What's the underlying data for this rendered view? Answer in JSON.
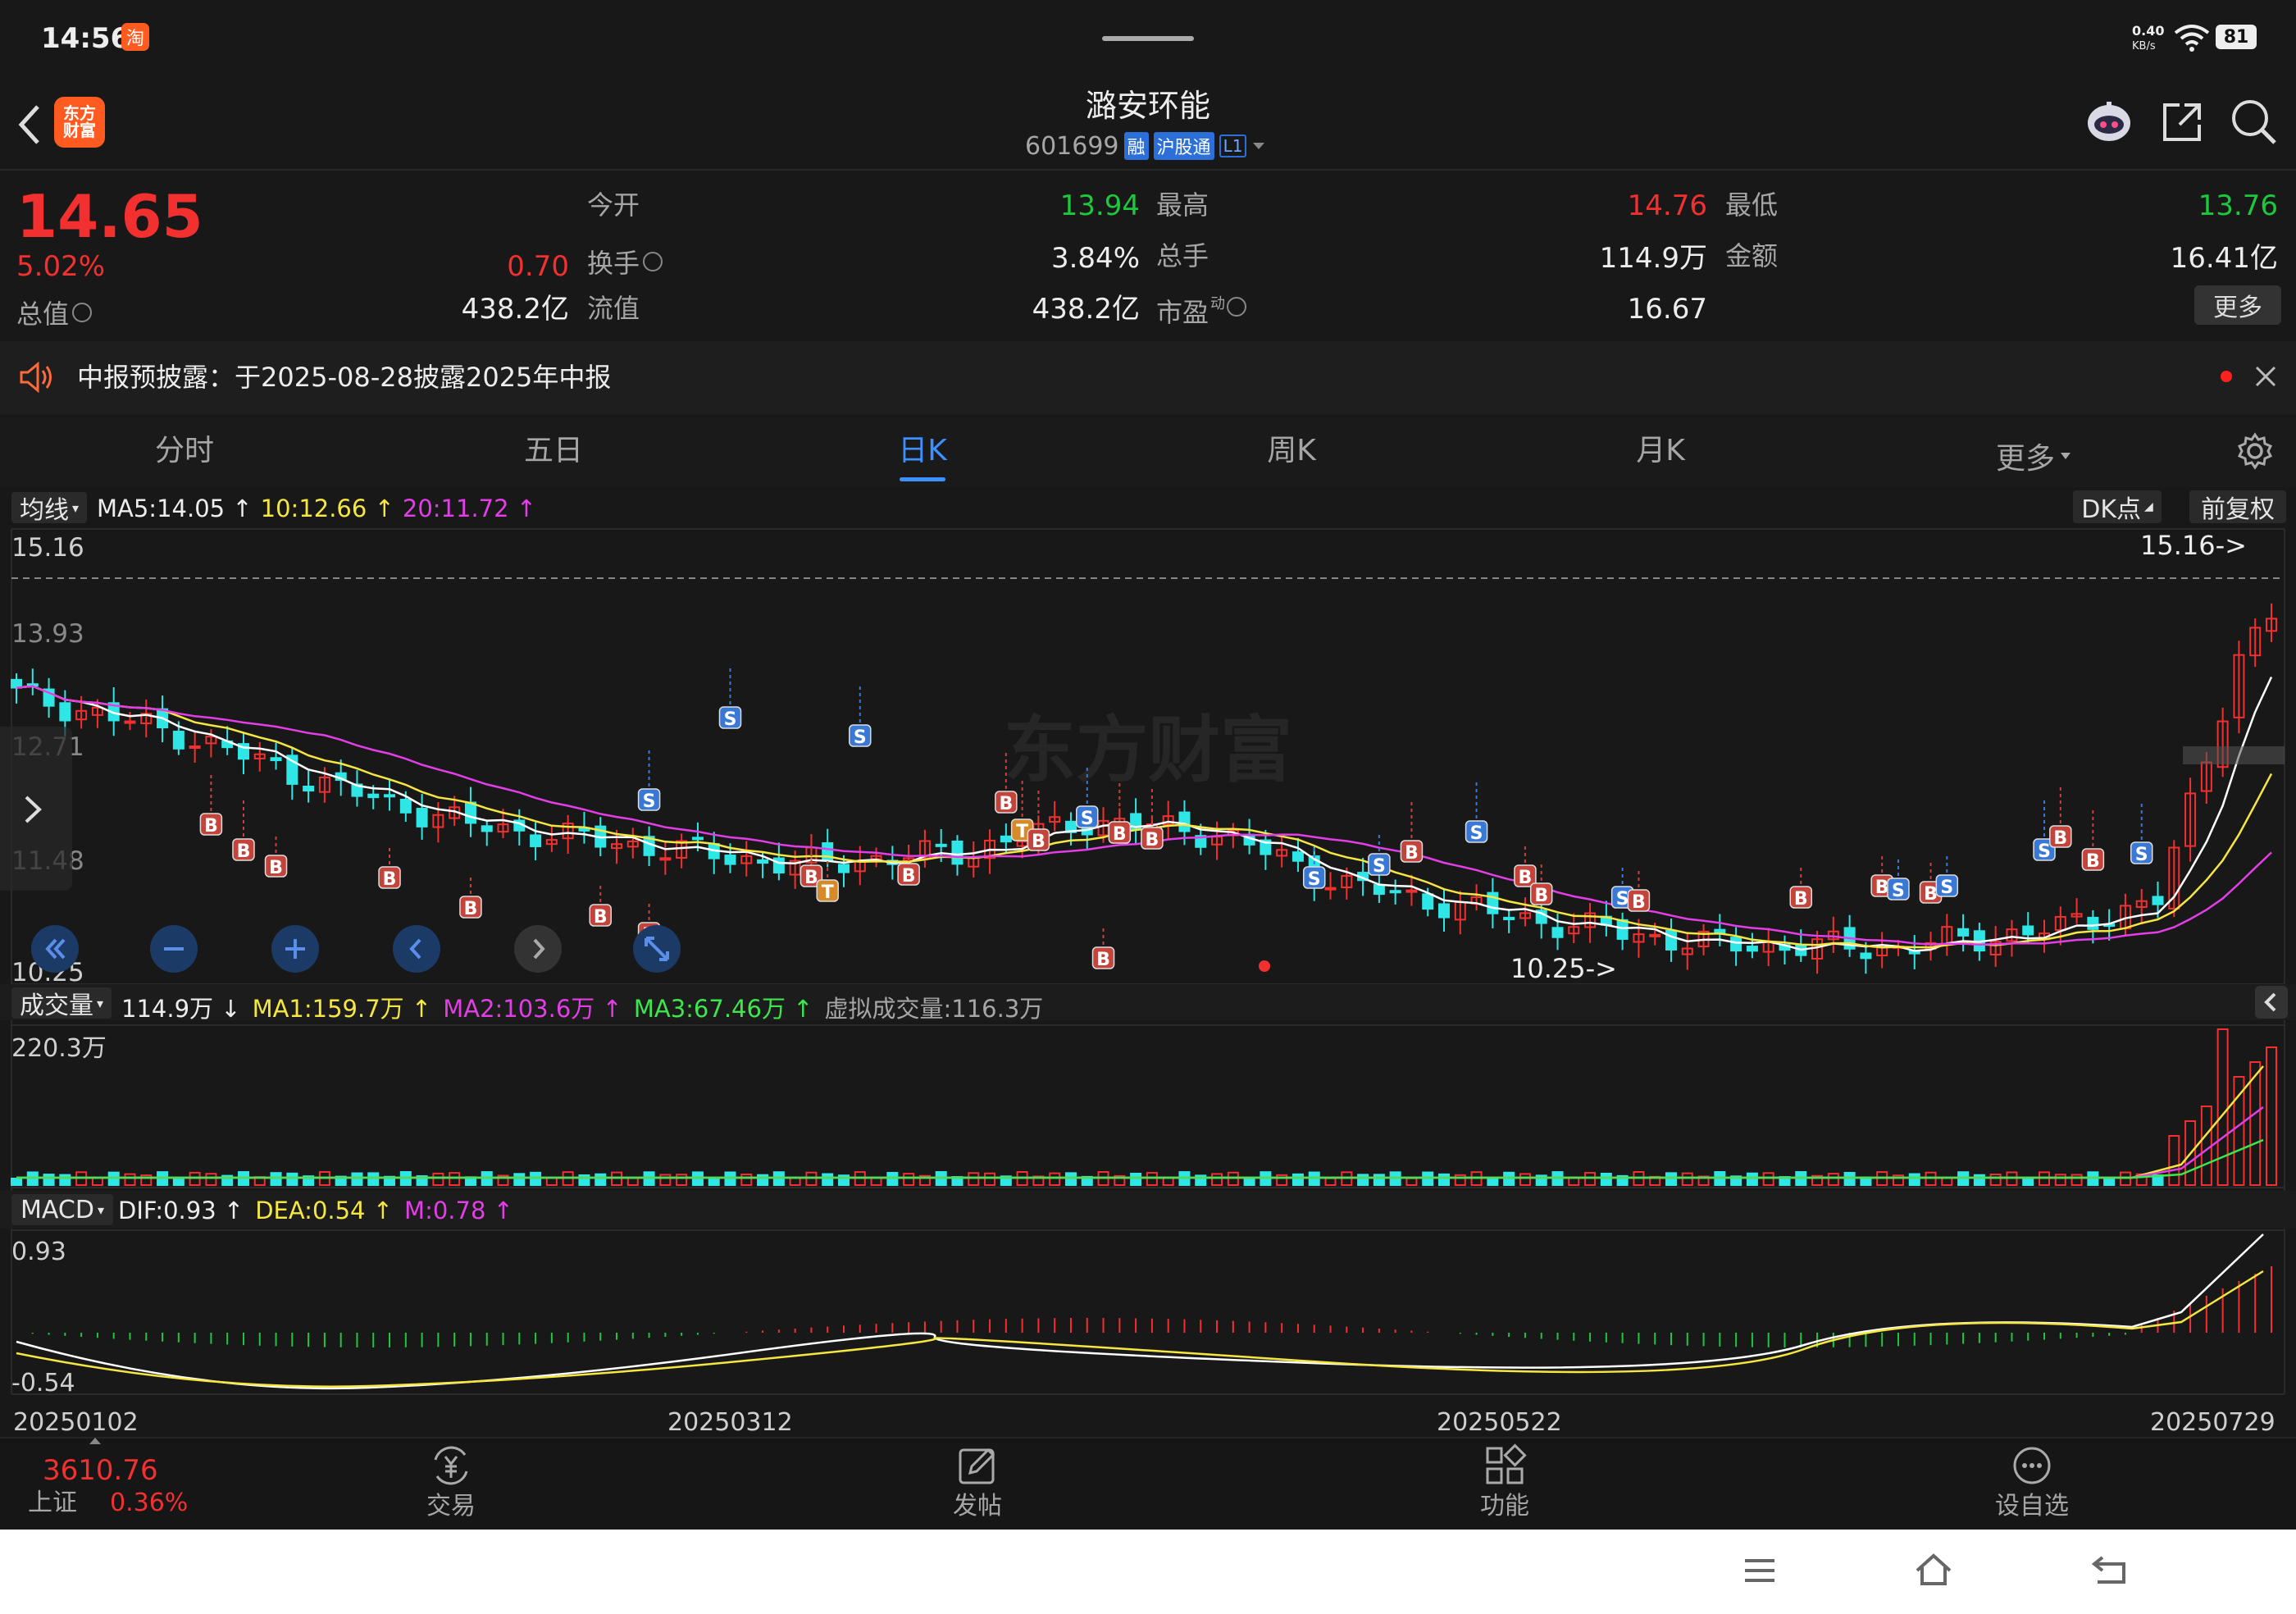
{
  "status_bar": {
    "time": "14:56",
    "app_badge": "淘",
    "net_speed_top": "0.40",
    "net_speed_bottom": "KB/s",
    "battery": "81"
  },
  "header": {
    "back_icon": "chevron-left-icon",
    "logo_text": "东方财富",
    "stock_name": "潞安环能",
    "stock_code": "601699",
    "tags": [
      "融",
      "沪股通",
      "L1"
    ],
    "icons": [
      "robot-assistant-icon",
      "share-icon",
      "search-icon"
    ]
  },
  "quote": {
    "price": "14.65",
    "change_pct": "5.02%",
    "change": "0.70",
    "total_value_label": "总值",
    "total_value": "438.2亿",
    "open_label": "今开",
    "open": "13.94",
    "turnover_label": "换手",
    "turnover": "3.84%",
    "float_label": "流值",
    "float_value": "438.2亿",
    "high_label": "最高",
    "high": "14.76",
    "volume_label": "总手",
    "volume": "114.9万",
    "pe_label": "市盈",
    "pe_sup": "动",
    "pe": "16.67",
    "low_label": "最低",
    "low": "13.76",
    "amount_label": "金额",
    "amount": "16.41亿",
    "more_label": "更多"
  },
  "notice": {
    "text": "中报预披露：于2025-08-28披露2025年中报"
  },
  "tabs": [
    "分时",
    "五日",
    "日K",
    "周K",
    "月K",
    "更多"
  ],
  "active_tab": "日K",
  "colors": {
    "up": "#f23030",
    "down": "#2fe6e6",
    "ma5": "#ffffff",
    "ma10": "#f5e642",
    "ma20": "#e23ee6",
    "active": "#3e8fff",
    "bg": "#181818"
  },
  "kline": {
    "ma_selector": "均线",
    "ma5": "MA5:14.05",
    "ma10": "10:12.66",
    "ma20": "20:11.72",
    "arrow_up": "↑",
    "dk_label": "DK点",
    "adjust_label": "前复权",
    "y_labels": [
      "15.16",
      "13.93",
      "12.71",
      "11.48",
      "10.25"
    ],
    "max_marker": "15.16->",
    "min_marker": "10.25->",
    "watermark": "东方财富"
  },
  "volume": {
    "selector": "成交量",
    "value": "114.9万",
    "value_arrow": "↓",
    "ma1": "MA1:159.7万",
    "ma2": "MA2:103.6万",
    "ma3": "MA3:67.46万",
    "virtual": "虚拟成交量:116.3万",
    "y_top": "220.3万"
  },
  "macd": {
    "selector": "MACD",
    "dif": "DIF:0.93",
    "dea": "DEA:0.54",
    "m": "M:0.78",
    "y_top": "0.93",
    "y_bottom": "-0.54"
  },
  "dates": [
    "20250102",
    "20250312",
    "20250522",
    "20250729"
  ],
  "bottom_bar": {
    "index_value": "3610.76",
    "index_name": "上证",
    "index_pct": "0.36%",
    "items": [
      {
        "label": "交易",
        "icon": "yuan-exchange-icon"
      },
      {
        "label": "发帖",
        "icon": "edit-post-icon"
      },
      {
        "label": "功能",
        "icon": "grid-apps-icon"
      },
      {
        "label": "设自选",
        "icon": "more-dots-icon"
      }
    ]
  },
  "chart_data": {
    "type": "candlestick",
    "ylim": [
      10.25,
      15.16
    ],
    "x_range": [
      "20250102",
      "20250729"
    ],
    "last_close": 14.65,
    "ma": {
      "ma5": 14.05,
      "ma10": 12.66,
      "ma20": 11.72
    },
    "volume_ylim_max": "220.3万",
    "macd_ylim": [
      -0.54,
      0.93
    ]
  }
}
